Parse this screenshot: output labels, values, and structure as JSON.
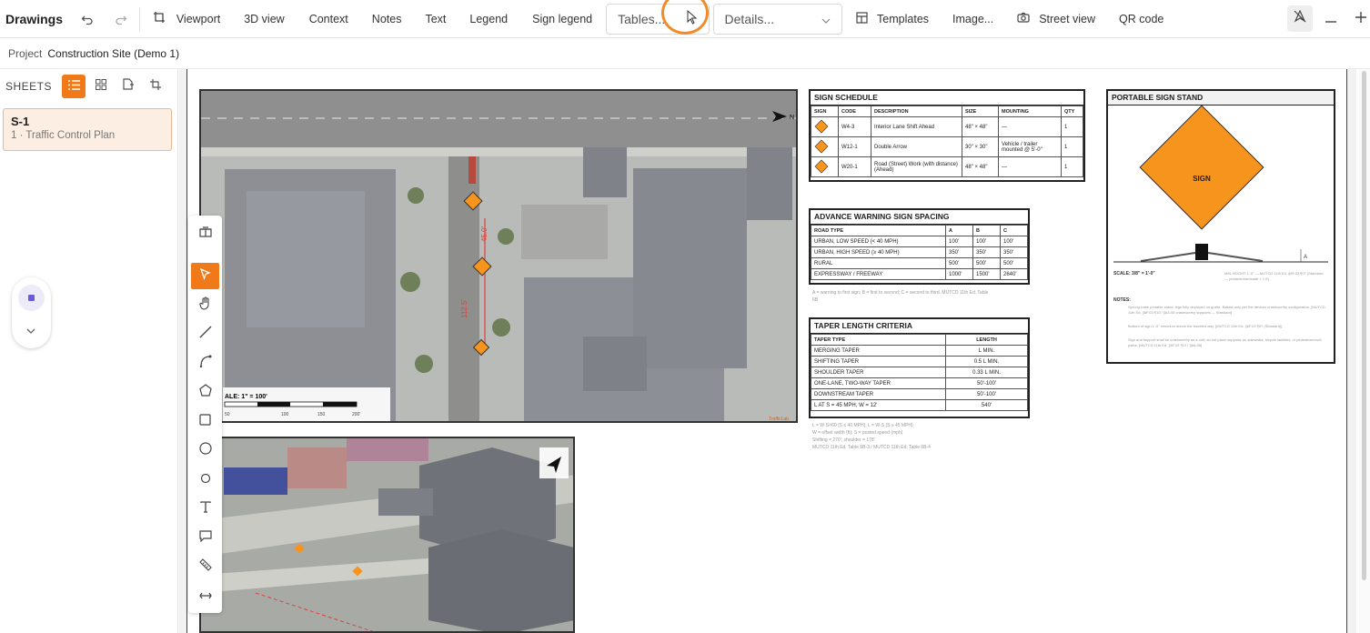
{
  "app": {
    "title": "Drawings"
  },
  "toolbar": {
    "viewport": "Viewport",
    "view3d": "3D view",
    "context": "Context",
    "notes": "Notes",
    "text": "Text",
    "legend": "Legend",
    "sign_legend": "Sign legend",
    "tables": "Tables...",
    "details": "Details...",
    "templates": "Templates",
    "image": "Image...",
    "street_view": "Street view",
    "qr_code": "QR code"
  },
  "breadcrumb": {
    "label": "Project",
    "value": "Construction Site (Demo 1)"
  },
  "sidebar": {
    "title": "SHEETS",
    "sheets": [
      {
        "id": "S-1",
        "name": "1 · Traffic Control Plan"
      }
    ]
  },
  "drawing": {
    "north": "N",
    "scale_label": "ALE: 1\" = 100'",
    "scale_ticks": [
      "50",
      "100",
      "150",
      "200'"
    ],
    "watermark": "TrafficLab",
    "dims": [
      "45.0'",
      "112.5'"
    ],
    "sign_schedule": {
      "title": "SIGN SCHEDULE",
      "headers": [
        "SIGN",
        "CODE",
        "DESCRIPTION",
        "SIZE",
        "MOUNTING",
        "QTY"
      ],
      "rows": [
        [
          "",
          "W4-3",
          "Interior Lane Shift Ahead",
          "48\" × 48\"",
          "—",
          "1"
        ],
        [
          "",
          "W12-1",
          "Double Arrow",
          "30\" × 30\"",
          "Vehicle / trailer mounted @ 5'-0\"",
          "1"
        ],
        [
          "",
          "W20-1",
          "Road (Street) Work (with distance) (Ahead)",
          "48\" × 48\"",
          "—",
          "1"
        ]
      ]
    },
    "warning_spacing": {
      "title": "ADVANCE WARNING SIGN SPACING",
      "headers": [
        "ROAD TYPE",
        "A",
        "B",
        "C"
      ],
      "rows": [
        [
          "URBAN, LOW SPEED (< 40 MPH)",
          "100'",
          "100'",
          "100'"
        ],
        [
          "URBAN, HIGH SPEED (≥ 40 MPH)",
          "350'",
          "350'",
          "350'"
        ],
        [
          "RURAL",
          "500'",
          "500'",
          "500'"
        ],
        [
          "EXPRESSWAY / FREEWAY",
          "1000'",
          "1500'",
          "2640'"
        ]
      ],
      "note": "A = warning to first sign; B = first to second; C = second to third. MUTCD 11th Ed. Table 6B"
    },
    "taper": {
      "title": "TAPER LENGTH CRITERIA",
      "headers": [
        "TAPER TYPE",
        "LENGTH"
      ],
      "rows": [
        [
          "MERGING TAPER",
          "L MIN."
        ],
        [
          "SHIFTING TAPER",
          "0.5 L MIN."
        ],
        [
          "SHOULDER TAPER",
          "0.33 L MIN."
        ],
        [
          "ONE-LANE, TWO-WAY TAPER",
          "50'-100'"
        ],
        [
          "DOWNSTREAM TAPER",
          "50'-100'"
        ],
        [
          "L AT S = 45 MPH, W = 12'",
          "540'"
        ]
      ],
      "notes": [
        "L = W·S²/60 (S ≤ 40 MPH); L = W·S (S ≥ 45 MPH)",
        "W = offset width (ft); S = posted speed (mph)",
        "Shifting = 270'; shoulder = 178'",
        "MUTCD 11th Ed. Table 6B-3 / MUTCD 11th Ed. Table 6B-4"
      ]
    },
    "sign_stand": {
      "title": "PORTABLE SIGN STAND",
      "sign_label": "SIGN",
      "dim": "A",
      "scale": "SCALE: 3/8\" = 1'-0\"",
      "min_height": "MIN HEIGHT 1'-0\" — MUTCD 11th Ed. §6F.03 ¶07 (Standard — portable/barricade = 1 ft)",
      "notes_title": "NOTES:",
      "notes": [
        "Sprung-base portable stand: legs fully deployed on grade. Ballast only per the devices crashworthy configuration. [MUTCD 11th Ed. §6F.03 ¶10 / §6A.06 crashworthy supports — Standard]",
        "Bottom of sign 1'-0\" minimum above the traveled way. [MUTCD 11th Ed. §6F.03 ¶07 (Standard)]",
        "Sign and support shall be crashworthy as a unit; do not place supports on sidewalks, bicycle facilities, or pedestrian/curb paths. [MUTCD 11th Ed. §6F.03 ¶10 / §6A.06]"
      ]
    }
  },
  "colors": {
    "accent": "#f07a1a",
    "sign": "#f7941d",
    "mini_nav": "#6b5bd8"
  }
}
